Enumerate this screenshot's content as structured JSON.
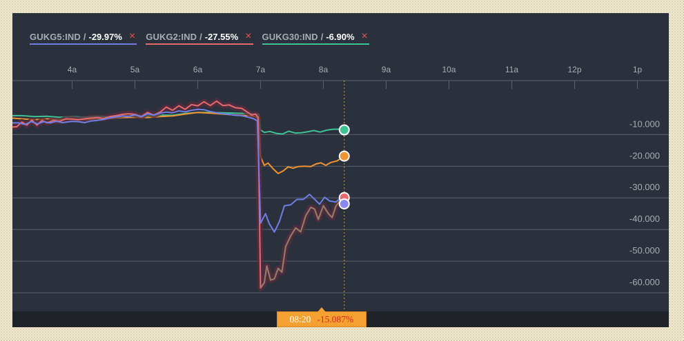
{
  "legend": [
    {
      "name": "GUKG5:IND",
      "sep": "/",
      "value": "-29.97%",
      "color": "#6f7fe6",
      "close_label": "×"
    },
    {
      "name": "GUKG2:IND",
      "sep": "/",
      "value": "-27.55%",
      "color": "#e86a6e",
      "close_label": "×"
    },
    {
      "name": "GUKG30:IND",
      "sep": "/",
      "value": "-6.90%",
      "color": "#3fc395",
      "close_label": "×"
    }
  ],
  "crosshair": {
    "time": "08:20",
    "value": "-15.087%"
  },
  "chart_data": {
    "type": "line",
    "xlabel": "",
    "ylabel": "",
    "x_ticks": [
      {
        "label": "4a",
        "t": 4
      },
      {
        "label": "5a",
        "t": 5
      },
      {
        "label": "6a",
        "t": 6
      },
      {
        "label": "7a",
        "t": 7
      },
      {
        "label": "8a",
        "t": 8
      },
      {
        "label": "9a",
        "t": 9
      },
      {
        "label": "10a",
        "t": 10
      },
      {
        "label": "11a",
        "t": 11
      },
      {
        "label": "12p",
        "t": 12
      },
      {
        "label": "1p",
        "t": 13
      }
    ],
    "y_ticks": [
      {
        "label": "-10.000",
        "v": -10
      },
      {
        "label": "-20.000",
        "v": -20
      },
      {
        "label": "-30.000",
        "v": -30
      },
      {
        "label": "-40.000",
        "v": -40
      },
      {
        "label": "-50.000",
        "v": -50
      },
      {
        "label": "-60.000",
        "v": -60
      }
    ],
    "x_range": [
      3.05,
      13.5
    ],
    "y_range": [
      1.2,
      -68.5
    ],
    "crosshair_t": 8.333,
    "grid": true,
    "series": [
      {
        "name": "GUKG30:IND",
        "color": "#3fc395",
        "marker_fill": "#3fc395",
        "points": [
          [
            3.05,
            -4.0
          ],
          [
            3.2,
            -4.0
          ],
          [
            3.4,
            -4.3
          ],
          [
            3.6,
            -4.2
          ],
          [
            3.8,
            -4.5
          ],
          [
            4.0,
            -4.3
          ],
          [
            4.2,
            -4.5
          ],
          [
            4.4,
            -4.2
          ],
          [
            4.6,
            -4.4
          ],
          [
            4.8,
            -4.1
          ],
          [
            5.0,
            -4.0
          ],
          [
            5.2,
            -4.1
          ],
          [
            5.4,
            -3.8
          ],
          [
            5.6,
            -3.9
          ],
          [
            5.8,
            -3.3
          ],
          [
            6.0,
            -3.0
          ],
          [
            6.2,
            -3.0
          ],
          [
            6.4,
            -3.1
          ],
          [
            6.6,
            -3.2
          ],
          [
            6.8,
            -3.3
          ],
          [
            6.92,
            -3.5
          ],
          [
            6.97,
            -3.6
          ],
          [
            7.0,
            -8.5
          ],
          [
            7.06,
            -9.3
          ],
          [
            7.15,
            -9.0
          ],
          [
            7.25,
            -9.6
          ],
          [
            7.35,
            -9.8
          ],
          [
            7.45,
            -8.9
          ],
          [
            7.55,
            -9.5
          ],
          [
            7.65,
            -9.4
          ],
          [
            7.75,
            -9.1
          ],
          [
            7.85,
            -8.7
          ],
          [
            7.95,
            -9.2
          ],
          [
            8.05,
            -8.6
          ],
          [
            8.15,
            -8.3
          ],
          [
            8.25,
            -8.3
          ],
          [
            8.333,
            -8.5
          ]
        ]
      },
      {
        "name": "",
        "color": "#f09331",
        "marker_fill": "#f09331",
        "points": [
          [
            3.05,
            -4.8
          ],
          [
            3.2,
            -5.0
          ],
          [
            3.4,
            -5.3
          ],
          [
            3.6,
            -5.0
          ],
          [
            3.8,
            -5.2
          ],
          [
            4.0,
            -5.0
          ],
          [
            4.2,
            -5.3
          ],
          [
            4.4,
            -5.0
          ],
          [
            4.6,
            -4.9
          ],
          [
            4.8,
            -4.6
          ],
          [
            5.0,
            -4.5
          ],
          [
            5.2,
            -4.6
          ],
          [
            5.4,
            -4.3
          ],
          [
            5.6,
            -4.1
          ],
          [
            5.8,
            -3.5
          ],
          [
            6.0,
            -3.0
          ],
          [
            6.2,
            -3.2
          ],
          [
            6.4,
            -3.5
          ],
          [
            6.6,
            -3.8
          ],
          [
            6.8,
            -4.0
          ],
          [
            6.92,
            -4.3
          ],
          [
            6.97,
            -5.0
          ],
          [
            7.0,
            -17.0
          ],
          [
            7.06,
            -19.7
          ],
          [
            7.12,
            -19.0
          ],
          [
            7.2,
            -20.8
          ],
          [
            7.28,
            -22.3
          ],
          [
            7.36,
            -21.5
          ],
          [
            7.44,
            -20.2
          ],
          [
            7.52,
            -20.6
          ],
          [
            7.6,
            -20.1
          ],
          [
            7.7,
            -20.0
          ],
          [
            7.8,
            -20.1
          ],
          [
            7.88,
            -19.3
          ],
          [
            7.96,
            -18.9
          ],
          [
            8.04,
            -19.7
          ],
          [
            8.12,
            -18.8
          ],
          [
            8.22,
            -18.3
          ],
          [
            8.333,
            -16.8
          ]
        ]
      },
      {
        "name": "GUKG2:IND",
        "color": "#e86a6e",
        "marker_fill": "#e86a6e",
        "points": [
          [
            3.05,
            -7.6
          ],
          [
            3.12,
            -7.5
          ],
          [
            3.2,
            -6.0
          ],
          [
            3.28,
            -7.0
          ],
          [
            3.36,
            -5.4
          ],
          [
            3.44,
            -7.0
          ],
          [
            3.52,
            -5.5
          ],
          [
            3.6,
            -6.3
          ],
          [
            3.7,
            -5.5
          ],
          [
            3.8,
            -5.8
          ],
          [
            3.9,
            -5.0
          ],
          [
            4.0,
            -5.1
          ],
          [
            4.1,
            -5.3
          ],
          [
            4.2,
            -5.0
          ],
          [
            4.3,
            -4.8
          ],
          [
            4.4,
            -4.6
          ],
          [
            4.5,
            -4.9
          ],
          [
            4.6,
            -4.3
          ],
          [
            4.7,
            -4.0
          ],
          [
            4.8,
            -3.6
          ],
          [
            4.9,
            -3.4
          ],
          [
            5.0,
            -3.6
          ],
          [
            5.1,
            -4.3
          ],
          [
            5.2,
            -3.0
          ],
          [
            5.3,
            -3.8
          ],
          [
            5.4,
            -2.9
          ],
          [
            5.5,
            -1.3
          ],
          [
            5.6,
            -2.3
          ],
          [
            5.7,
            -0.9
          ],
          [
            5.8,
            -2.0
          ],
          [
            5.9,
            -0.5
          ],
          [
            6.0,
            -0.9
          ],
          [
            6.1,
            0.4
          ],
          [
            6.2,
            -0.8
          ],
          [
            6.3,
            0.6
          ],
          [
            6.4,
            -0.8
          ],
          [
            6.5,
            -0.6
          ],
          [
            6.6,
            -1.5
          ],
          [
            6.7,
            -1.7
          ],
          [
            6.8,
            -3.0
          ],
          [
            6.86,
            -3.8
          ],
          [
            6.92,
            -3.5
          ],
          [
            6.96,
            -4.5
          ],
          [
            7.0,
            -58.5
          ],
          [
            7.06,
            -56.8
          ],
          [
            7.1,
            -51.5
          ],
          [
            7.16,
            -56.0
          ],
          [
            7.22,
            -55.6
          ],
          [
            7.28,
            -52.3
          ],
          [
            7.34,
            -53.5
          ],
          [
            7.4,
            -45.4
          ],
          [
            7.48,
            -42.0
          ],
          [
            7.56,
            -39.5
          ],
          [
            7.64,
            -40.7
          ],
          [
            7.72,
            -35.6
          ],
          [
            7.8,
            -33.0
          ],
          [
            7.86,
            -33.5
          ],
          [
            7.92,
            -36.8
          ],
          [
            8.0,
            -32.5
          ],
          [
            8.08,
            -35.0
          ],
          [
            8.14,
            -36.2
          ],
          [
            8.2,
            -32.6
          ],
          [
            8.26,
            -31.0
          ],
          [
            8.333,
            -29.9
          ]
        ]
      },
      {
        "name": "GUKG5:IND",
        "color": "#6f7fe6",
        "marker_fill": "#8a86f2",
        "points": [
          [
            3.05,
            -6.3
          ],
          [
            3.15,
            -6.3
          ],
          [
            3.25,
            -6.8
          ],
          [
            3.35,
            -5.9
          ],
          [
            3.45,
            -6.6
          ],
          [
            3.55,
            -5.9
          ],
          [
            3.65,
            -6.3
          ],
          [
            3.75,
            -5.8
          ],
          [
            3.85,
            -6.2
          ],
          [
            4.0,
            -5.8
          ],
          [
            4.1,
            -5.9
          ],
          [
            4.2,
            -6.2
          ],
          [
            4.3,
            -5.7
          ],
          [
            4.4,
            -5.5
          ],
          [
            4.5,
            -5.2
          ],
          [
            4.6,
            -4.7
          ],
          [
            4.7,
            -4.4
          ],
          [
            4.8,
            -4.1
          ],
          [
            4.9,
            -4.3
          ],
          [
            5.0,
            -3.7
          ],
          [
            5.1,
            -4.4
          ],
          [
            5.2,
            -3.4
          ],
          [
            5.3,
            -3.8
          ],
          [
            5.4,
            -3.2
          ],
          [
            5.5,
            -2.9
          ],
          [
            5.6,
            -3.1
          ],
          [
            5.7,
            -2.5
          ],
          [
            5.8,
            -2.8
          ],
          [
            5.9,
            -2.3
          ],
          [
            6.0,
            -2.0
          ],
          [
            6.1,
            -2.1
          ],
          [
            6.2,
            -2.7
          ],
          [
            6.3,
            -3.1
          ],
          [
            6.4,
            -3.4
          ],
          [
            6.5,
            -3.6
          ],
          [
            6.6,
            -3.9
          ],
          [
            6.7,
            -4.0
          ],
          [
            6.8,
            -4.5
          ],
          [
            6.88,
            -4.9
          ],
          [
            6.95,
            -5.6
          ],
          [
            7.0,
            -38.0
          ],
          [
            7.08,
            -35.0
          ],
          [
            7.14,
            -38.2
          ],
          [
            7.22,
            -40.8
          ],
          [
            7.3,
            -37.5
          ],
          [
            7.38,
            -32.5
          ],
          [
            7.48,
            -32.2
          ],
          [
            7.58,
            -30.5
          ],
          [
            7.68,
            -30.5
          ],
          [
            7.78,
            -28.9
          ],
          [
            7.86,
            -30.4
          ],
          [
            7.94,
            -32.0
          ],
          [
            8.02,
            -29.8
          ],
          [
            8.1,
            -31.0
          ],
          [
            8.2,
            -31.3
          ],
          [
            8.28,
            -30.0
          ],
          [
            8.333,
            -31.9
          ]
        ]
      }
    ]
  }
}
